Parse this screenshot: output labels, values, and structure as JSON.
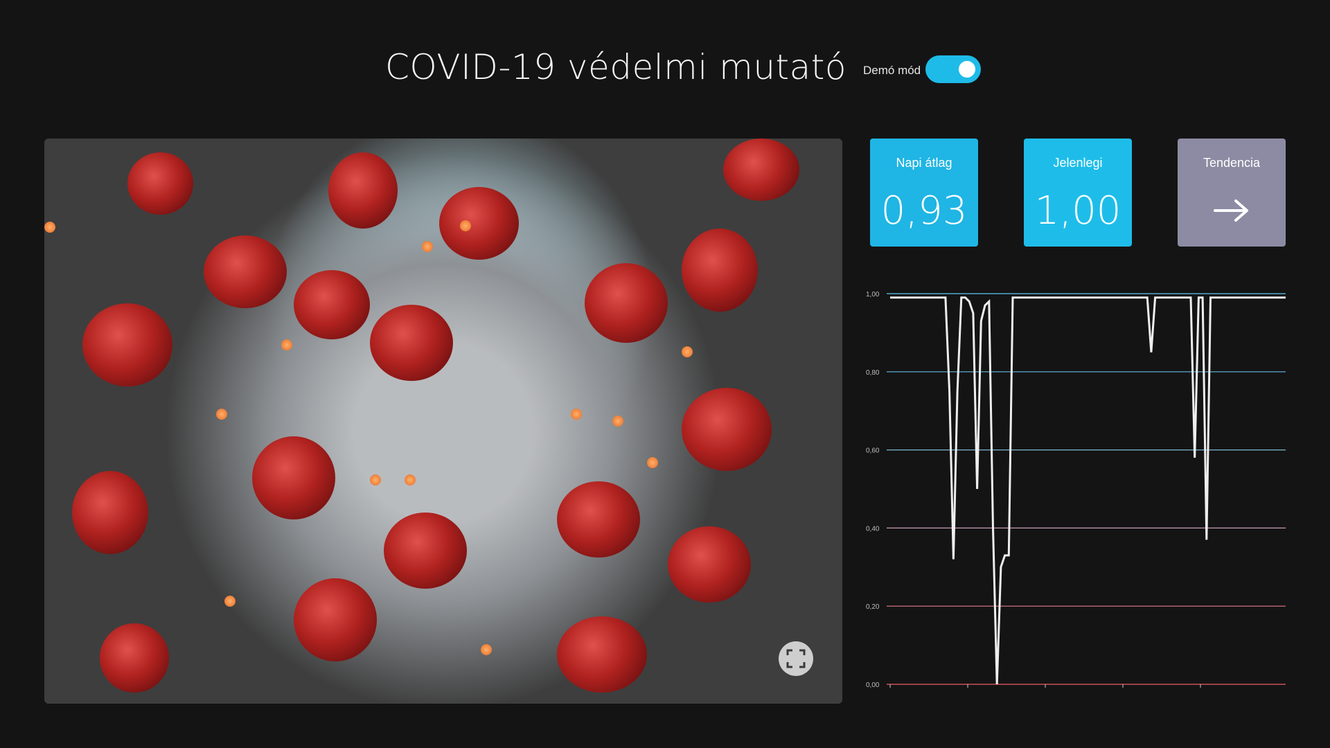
{
  "header": {
    "title": "COVID-19 védelmi mutató",
    "demo_label": "Demó mód",
    "demo_enabled": true
  },
  "image_panel": {
    "fullscreen_icon": "expand-icon"
  },
  "cards": [
    {
      "label": "Napi átlag",
      "value": "0,93",
      "color": "#1fb5e4"
    },
    {
      "label": "Jelenlegi",
      "value": "1,00",
      "color": "#1ebde9"
    },
    {
      "label": "Tendencia",
      "icon": "arrow-right-icon",
      "color": "#8c8ba3"
    }
  ],
  "chart_data": {
    "type": "line",
    "ylim": [
      0,
      1
    ],
    "yticks": [
      "1,00",
      "0,80",
      "0,60",
      "0,40",
      "0,20",
      "0,00"
    ],
    "gridline_colors": [
      "#5ec7ef",
      "#62b9e3",
      "#7ab6d4",
      "#c79ab6",
      "#e57a86",
      "#ef5b66"
    ],
    "x": [
      0,
      14,
      15,
      16,
      17,
      18,
      19,
      20,
      21,
      22,
      23,
      24,
      25,
      26,
      27,
      28,
      29,
      30,
      31,
      32,
      33,
      34,
      35,
      36,
      37,
      38,
      39,
      40,
      41,
      42,
      43,
      44,
      45,
      46,
      47,
      48,
      65,
      66,
      67,
      68,
      69,
      75,
      76,
      77,
      78,
      79,
      80,
      81,
      82,
      83,
      84,
      85,
      86,
      87,
      88,
      89,
      90,
      91,
      100
    ],
    "y": [
      0.99,
      0.99,
      0.75,
      0.32,
      0.75,
      0.99,
      0.99,
      0.98,
      0.95,
      0.5,
      0.93,
      0.97,
      0.98,
      0.4,
      0.0,
      0.3,
      0.33,
      0.33,
      0.99,
      0.99,
      0.99,
      0.99,
      0.99,
      0.99,
      0.99,
      0.99,
      0.99,
      0.99,
      0.99,
      0.99,
      0.99,
      0.99,
      0.99,
      0.99,
      0.99,
      0.99,
      0.99,
      0.85,
      0.99,
      0.99,
      0.99,
      0.99,
      0.99,
      0.58,
      0.99,
      0.99,
      0.37,
      0.99,
      0.99,
      0.99,
      0.99,
      0.99,
      0.99,
      0.99,
      0.99,
      0.99,
      0.99,
      0.99,
      0.99
    ]
  }
}
